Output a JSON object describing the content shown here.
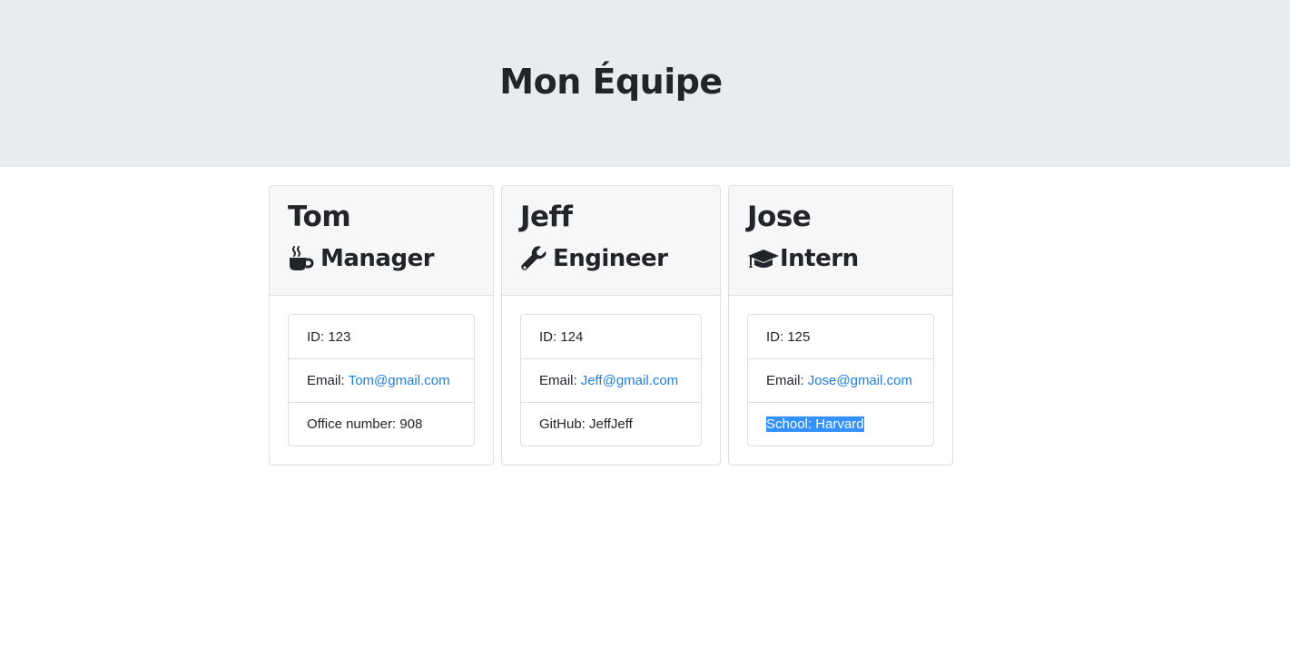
{
  "header": {
    "title": "Mon Équipe"
  },
  "employees": [
    {
      "name": "Tom",
      "role": "Manager",
      "role_icon": "mug-hot-icon",
      "id": "ID: 123",
      "email_label": "Email:",
      "email": "Tom@gmail.com",
      "extra": "Office number: 908"
    },
    {
      "name": "Jeff",
      "role": "Engineer",
      "role_icon": "wrench-icon",
      "id": "ID: 124",
      "email_label": "Email:",
      "email": "Jeff@gmail.com",
      "extra": "GitHub: JeffJeff"
    },
    {
      "name": "Jose",
      "role": "Intern",
      "role_icon": "graduation-cap-icon",
      "id": "ID: 125",
      "email_label": "Email:",
      "email": "Jose@gmail.com",
      "extra": "School: Harvard",
      "extra_selected": true
    }
  ],
  "colors": {
    "jumbotron_bg": "#e9ecef",
    "card_header_bg": "#f7f7f7",
    "link": "#1e7fe0",
    "selection": "#3390ff"
  }
}
